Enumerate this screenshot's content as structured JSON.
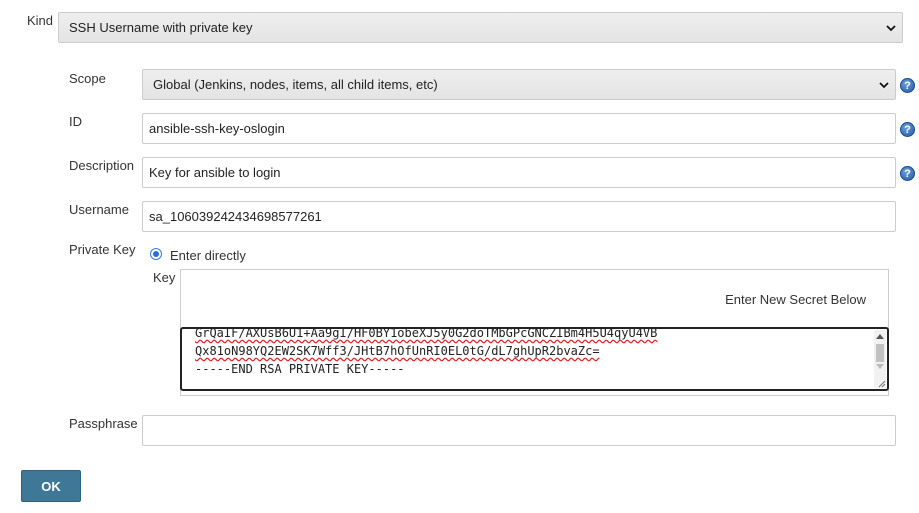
{
  "kind": {
    "label": "Kind",
    "value": "SSH Username with private key"
  },
  "scope": {
    "label": "Scope",
    "value": "Global (Jenkins, nodes, items, all child items, etc)"
  },
  "id_field": {
    "label": "ID",
    "value": "ansible-ssh-key-oslogin"
  },
  "description": {
    "label": "Description",
    "value": "Key for ansible to login"
  },
  "username": {
    "label": "Username",
    "value": "sa_106039242434698577261"
  },
  "private_key": {
    "label": "Private Key",
    "radio_label": "Enter directly",
    "key_label": "Key",
    "secret_text": "Enter New Secret Below",
    "lines": [
      "GrQaIF/AXUsB6U1+Aa9gI/HF0BY1obeXJ5y0G2doTMbGPcGNCZIBm4H5U4qyU4VB",
      "Qx81oN98YQ2EW2SK7Wff3/JHtB7hOfUnRI0EL0tG/dL7ghUpR2bvaZc=",
      "-----END RSA PRIVATE KEY-----"
    ]
  },
  "passphrase": {
    "label": "Passphrase",
    "value": ""
  },
  "ok_button": {
    "label": "OK"
  },
  "colors": {
    "button": "#3f7796",
    "help_icon": "#1e5aa8"
  }
}
